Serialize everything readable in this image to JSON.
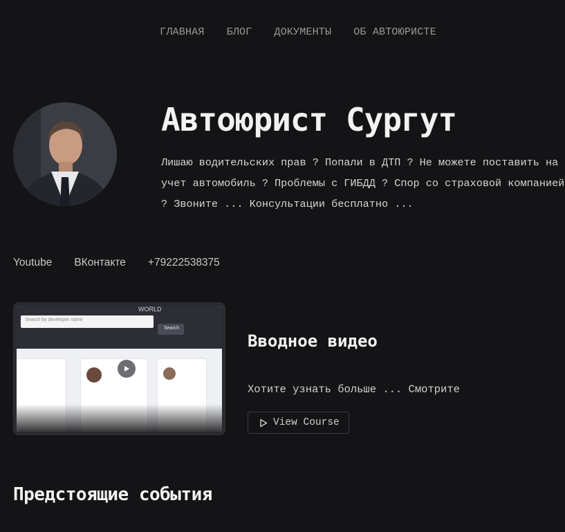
{
  "nav": {
    "items": [
      "ГЛАВНАЯ",
      "БЛОГ",
      "ДОКУМЕНТЫ",
      "ОБ АВТОЮРИСТЕ"
    ]
  },
  "hero": {
    "title": "Автоюрист Сургут",
    "description": "Лишаю водительских прав ? Попали в ДТП ? Не можете поставить на учет автомобиль ? Проблемы с ГИБДД ? Спор со страховой компанией ? Звоните ... Консультации бесплатно ..."
  },
  "links": {
    "youtube": "Youtube",
    "vk": "ВКонтакте",
    "phone": "+79222538375"
  },
  "video": {
    "title": "Вводное видео",
    "description": "Хотите узнать больше ... Смотрите",
    "button_label": "View Course",
    "thumbnail": {
      "search_placeholder": "Search by developer name",
      "search_button": "Search",
      "heading": "WORLD"
    }
  },
  "events": {
    "title": "Предстоящие события"
  }
}
